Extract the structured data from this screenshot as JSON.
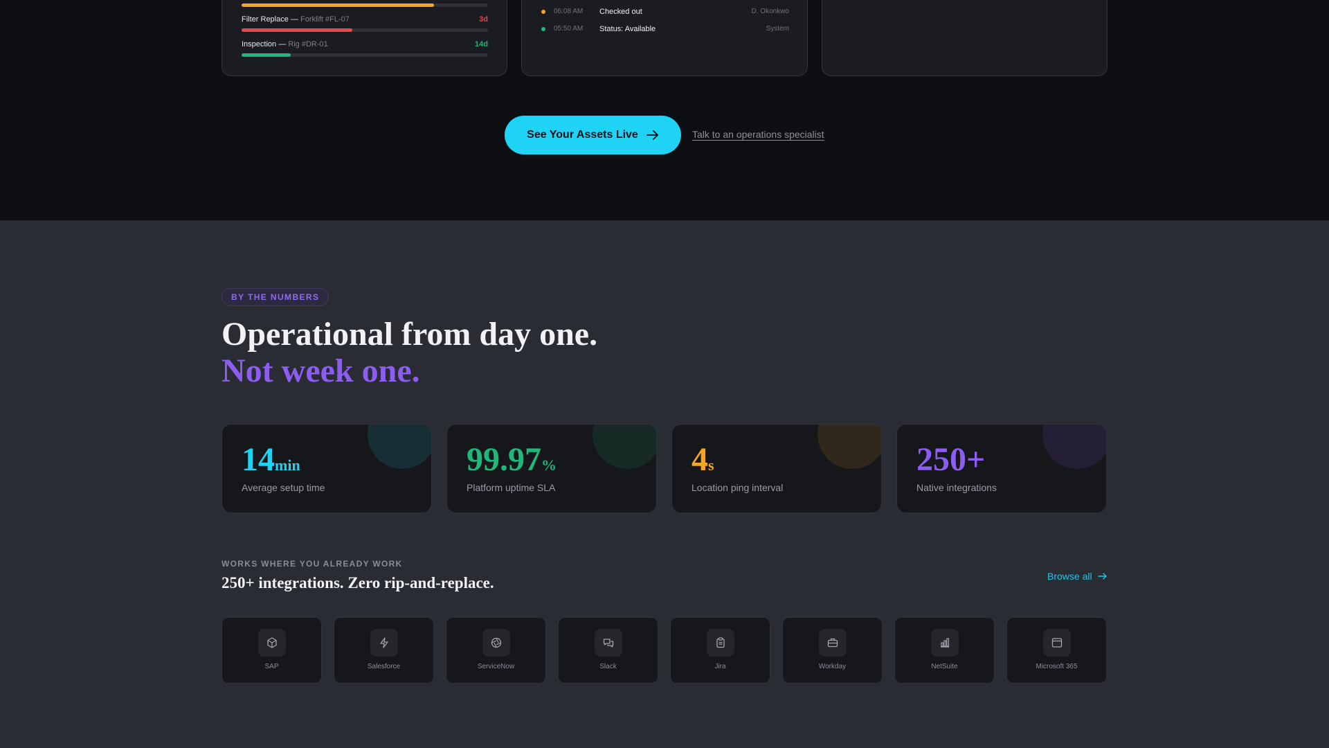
{
  "maintenance": [
    {
      "task": "",
      "asset": "",
      "days": "",
      "color": "#f5a524",
      "progress": 0.78
    },
    {
      "task": "Filter Replace",
      "asset": "Forklift #FL-07",
      "days": "3d",
      "color": "#e5484d",
      "progress": 0.45
    },
    {
      "task": "Inspection",
      "asset": "Rig #DR-01",
      "days": "14d",
      "color": "#1fb87a",
      "progress": 0.2
    }
  ],
  "activity": [
    {
      "time": "06:08 AM",
      "event": "Checked out",
      "actor": "D. Okonkwo",
      "dot": "#f5a524"
    },
    {
      "time": "05:50 AM",
      "event": "Status: Available",
      "actor": "System",
      "dot": "#1fb87a"
    }
  ],
  "cta": {
    "primary_label": "See Your Assets Live",
    "secondary_label": "Talk to an operations specialist"
  },
  "numbers": {
    "eyebrow": "BY THE NUMBERS",
    "headline": "Operational from day one.",
    "headline_accent": "Not week one.",
    "stats": [
      {
        "value": "14",
        "unit": "min",
        "label": "Average setup time",
        "color": "#1fd3f5"
      },
      {
        "value": "99.97",
        "unit": "%",
        "label": "Platform uptime SLA",
        "color": "#1fb87a"
      },
      {
        "value": "4",
        "unit": "s",
        "label": "Location ping interval",
        "color": "#f5a524"
      },
      {
        "value": "250+",
        "unit": "",
        "label": "Native integrations",
        "color": "#8d5cf0"
      }
    ]
  },
  "integrations": {
    "eyebrow": "WORKS WHERE YOU ALREADY WORK",
    "title": "250+ integrations. Zero rip-and-replace.",
    "browse_label": "Browse all",
    "items": [
      {
        "name": "SAP",
        "icon": "cube-icon"
      },
      {
        "name": "Salesforce",
        "icon": "lightning-icon"
      },
      {
        "name": "ServiceNow",
        "icon": "aperture-icon"
      },
      {
        "name": "Slack",
        "icon": "chat-icon"
      },
      {
        "name": "Jira",
        "icon": "clipboard-icon"
      },
      {
        "name": "Workday",
        "icon": "briefcase-icon"
      },
      {
        "name": "NetSuite",
        "icon": "bar-chart-icon"
      },
      {
        "name": "Microsoft 365",
        "icon": "window-icon"
      }
    ]
  }
}
